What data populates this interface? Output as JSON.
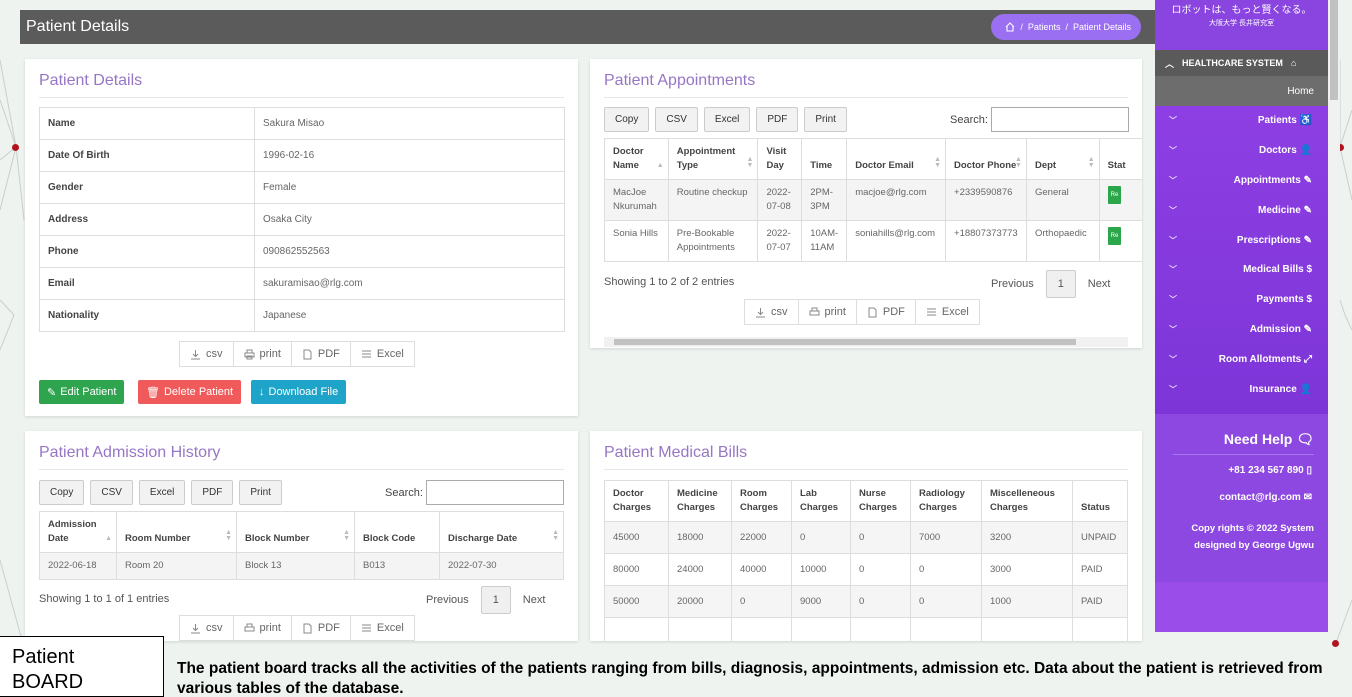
{
  "topbar": {
    "title": "Patient Details",
    "breadcrumb": [
      "Patients",
      "Patient Details"
    ],
    "separator": "/"
  },
  "patient_card": {
    "title": "Patient Details",
    "fields": [
      {
        "label": "Name",
        "value": "Sakura Misao"
      },
      {
        "label": "Date Of Birth",
        "value": "1996-02-16"
      },
      {
        "label": "Gender",
        "value": "Female"
      },
      {
        "label": "Address",
        "value": "Osaka City"
      },
      {
        "label": "Phone",
        "value": "090862552563"
      },
      {
        "label": "Email",
        "value": "sakuramisao@rlg.com"
      },
      {
        "label": "Nationality",
        "value": "Japanese"
      }
    ],
    "export": {
      "csv": "csv",
      "print": "print",
      "pdf": "PDF",
      "excel": "Excel"
    },
    "buttons": {
      "edit": "Edit Patient",
      "delete": "Delete Patient",
      "download": "Download File"
    }
  },
  "appointments_card": {
    "title": "Patient Appointments",
    "buttons": [
      "Copy",
      "CSV",
      "Excel",
      "PDF",
      "Print"
    ],
    "search_label": "Search:",
    "columns": [
      "Doctor Name",
      "Appointment Type",
      "Visit Day",
      "Time",
      "Doctor Email",
      "Doctor Phone",
      "Dept",
      "Stat"
    ],
    "rows": [
      [
        "MacJoe Nkurumah",
        "Routine checkup",
        "2022-07-08",
        "2PM-3PM",
        "macjoe@rlg.com",
        "+2339590876",
        "General",
        "Re"
      ],
      [
        "Sonia Hills",
        "Pre-Bookable Appointments",
        "2022-07-07",
        "10AM-11AM",
        "soniahills@rlg.com",
        "+18807373773",
        "Orthopaedic",
        "Re"
      ]
    ],
    "info": "Showing 1 to 2 of 2 entries",
    "pager": {
      "prev": "Previous",
      "page": "1",
      "next": "Next"
    },
    "export": {
      "csv": "csv",
      "print": "print",
      "pdf": "PDF",
      "excel": "Excel"
    },
    "status_color": "#2ca64b"
  },
  "admission_card": {
    "title": "Patient Admission History",
    "buttons": [
      "Copy",
      "CSV",
      "Excel",
      "PDF",
      "Print"
    ],
    "search_label": "Search:",
    "columns": [
      "Admission Date",
      "Room Number",
      "Block Number",
      "Block Code",
      "Discharge Date"
    ],
    "rows": [
      [
        "2022-06-18",
        "Room 20",
        "Block 13",
        "B013",
        "2022-07-30"
      ]
    ],
    "info": "Showing 1 to 1 of 1 entries",
    "pager": {
      "prev": "Previous",
      "page": "1",
      "next": "Next"
    },
    "export": {
      "csv": "csv",
      "print": "print",
      "pdf": "PDF",
      "excel": "Excel"
    }
  },
  "bills_card": {
    "title": "Patient Medical Bills",
    "columns": [
      "Doctor Charges",
      "Medicine Charges",
      "Room Charges",
      "Lab Charges",
      "Nurse Charges",
      "Radiology Charges",
      "Miscelleneous Charges",
      "Status"
    ],
    "rows": [
      [
        "45000",
        "18000",
        "22000",
        "0",
        "0",
        "7000",
        "3200",
        "UNPAID"
      ],
      [
        "80000",
        "24000",
        "40000",
        "10000",
        "0",
        "0",
        "3000",
        "PAID"
      ],
      [
        "50000",
        "20000",
        "0",
        "9000",
        "0",
        "0",
        "1000",
        "PAID"
      ]
    ]
  },
  "sidebar": {
    "banner_line1": "ロボットは、もっと賢くなる。",
    "banner_line2": "大阪大学 長井研究室",
    "section": "HEALTHCARE SYSTEM",
    "home": "Home",
    "items": [
      {
        "label": "Patients",
        "icon": "wheelchair-icon"
      },
      {
        "label": "Doctors",
        "icon": "user-icon"
      },
      {
        "label": "Appointments",
        "icon": "edit-icon"
      },
      {
        "label": "Medicine",
        "icon": "edit-icon"
      },
      {
        "label": "Prescriptions",
        "icon": "edit-icon"
      },
      {
        "label": "Medical Bills",
        "icon": "dollar-icon"
      },
      {
        "label": "Payments",
        "icon": "dollar-icon"
      },
      {
        "label": "Admission",
        "icon": "edit-icon"
      },
      {
        "label": "Room Allotments",
        "icon": "bed-icon"
      },
      {
        "label": "Insurance",
        "icon": "user-shield-icon"
      }
    ],
    "help_title": "Need Help",
    "phone": "+81 234 567 890",
    "email": "contact@rlg.com",
    "copyright_line1": "Copy rights © 2022 System",
    "copyright_line2": "designed by George Ugwu",
    "accent": "#8c3fe0"
  },
  "caption": {
    "label_line1": "Patient",
    "label_line2": "BOARD",
    "text": "The patient board tracks all the activities of the patients ranging from bills, diagnosis, appointments, admission etc. Data about the patient is retrieved from various tables of the database."
  }
}
